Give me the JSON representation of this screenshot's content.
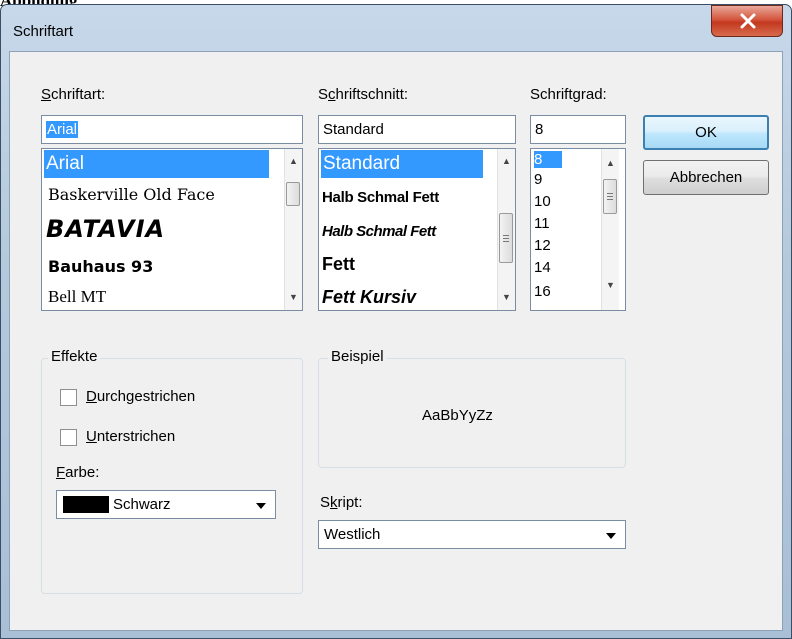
{
  "caption": "Abbildung",
  "window": {
    "title": "Schriftart",
    "close_icon": "close-icon"
  },
  "font": {
    "label_pre": "",
    "label_ul": "S",
    "label_post": "chriftart:",
    "value": "Arial",
    "items": [
      "Arial",
      "Baskerville Old Face",
      "BATAVIA",
      "Bauhaus 93",
      "Bell MT"
    ]
  },
  "style": {
    "label_pre": "S",
    "label_ul": "c",
    "label_post": "hriftschnitt:",
    "value": "Standard",
    "items": [
      "Standard",
      "Halb Schmal Fett",
      "Halb Schmal Fett",
      "Fett",
      "Fett Kursiv"
    ]
  },
  "size": {
    "label_pre": "Schrift",
    "label_ul": "g",
    "label_post": "rad:",
    "value": "8",
    "items": [
      "8",
      "9",
      "10",
      "11",
      "12",
      "14",
      "16"
    ]
  },
  "buttons": {
    "ok": "OK",
    "cancel": "Abbrechen"
  },
  "effects": {
    "title": "Effekte",
    "strike_ul": "D",
    "strike_post": "urchgestrichen",
    "underline_ul": "U",
    "underline_post": "nterstrichen",
    "color_label_ul": "F",
    "color_label_post": "arbe:",
    "color_value": "Schwarz",
    "color_swatch": "#000000"
  },
  "sample": {
    "title": "Beispiel",
    "text": "AaBbYyZz"
  },
  "script": {
    "label_pre": "S",
    "label_ul": "k",
    "label_post": "ript:",
    "value": "Westlich"
  }
}
